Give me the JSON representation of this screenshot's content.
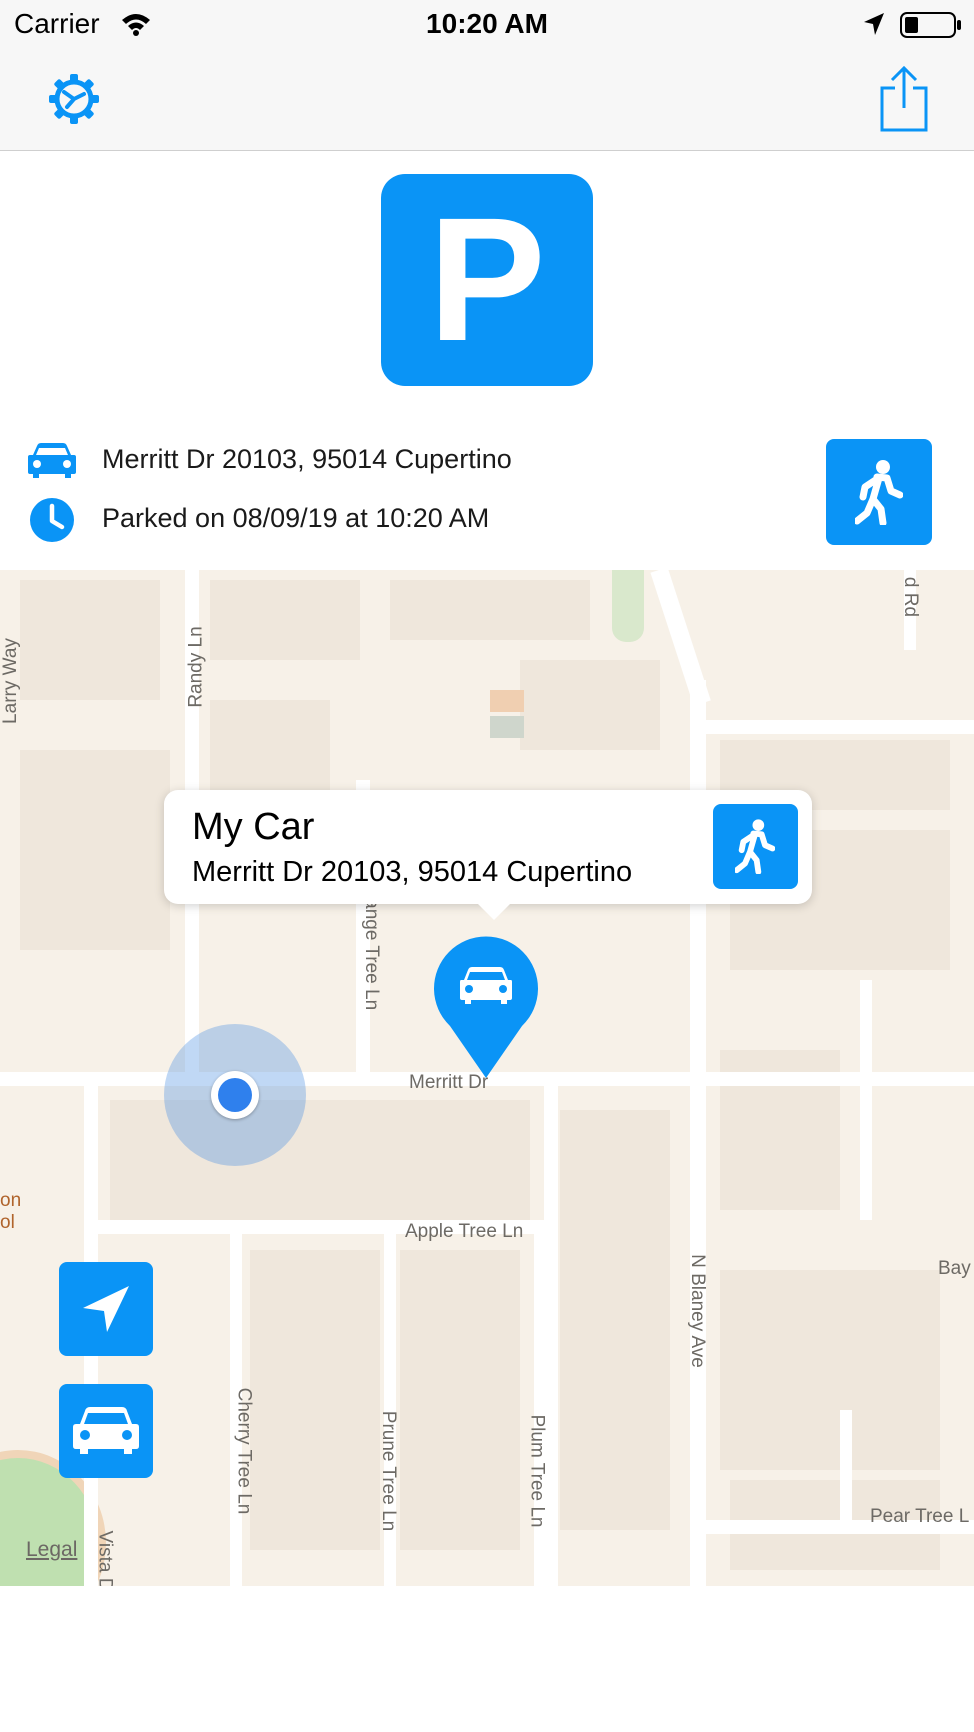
{
  "status_bar": {
    "carrier": "Carrier",
    "time": "10:20 AM"
  },
  "nav": {
    "settings_icon": "gear-icon",
    "share_icon": "share-icon"
  },
  "logo": {
    "letter": "P"
  },
  "parking_info": {
    "address": "Merritt Dr 20103, 95014 Cupertino",
    "parked_text": "Parked on 08/09/19 at 10:20 AM"
  },
  "callout": {
    "title": "My Car",
    "subtitle": "Merritt Dr 20103, 95014 Cupertino"
  },
  "map": {
    "legal": "Legal",
    "labels": {
      "larry_way": "Larry Way",
      "randy_ln": "Randy Ln",
      "orange_tree_ln": "range Tree Ln",
      "merritt_dr": "Merritt Dr",
      "apple_tree_ln": "Apple Tree Ln",
      "n_blaney_ave": "N Blaney Ave",
      "cherry_tree_ln": "Cherry Tree Ln",
      "prune_tree_ln": "Prune Tree Ln",
      "plum_tree_ln": "Plum Tree Ln",
      "pear_tree_ln": "Pear Tree L",
      "vista_d": "Vista D",
      "bay": "Bay",
      "rd": "d Rd",
      "school_on": "on",
      "school_ol": "ol"
    }
  },
  "colors": {
    "accent": "#0a94f6",
    "map_bg": "#f7f1e8",
    "user_dot": "#2f80ed"
  }
}
